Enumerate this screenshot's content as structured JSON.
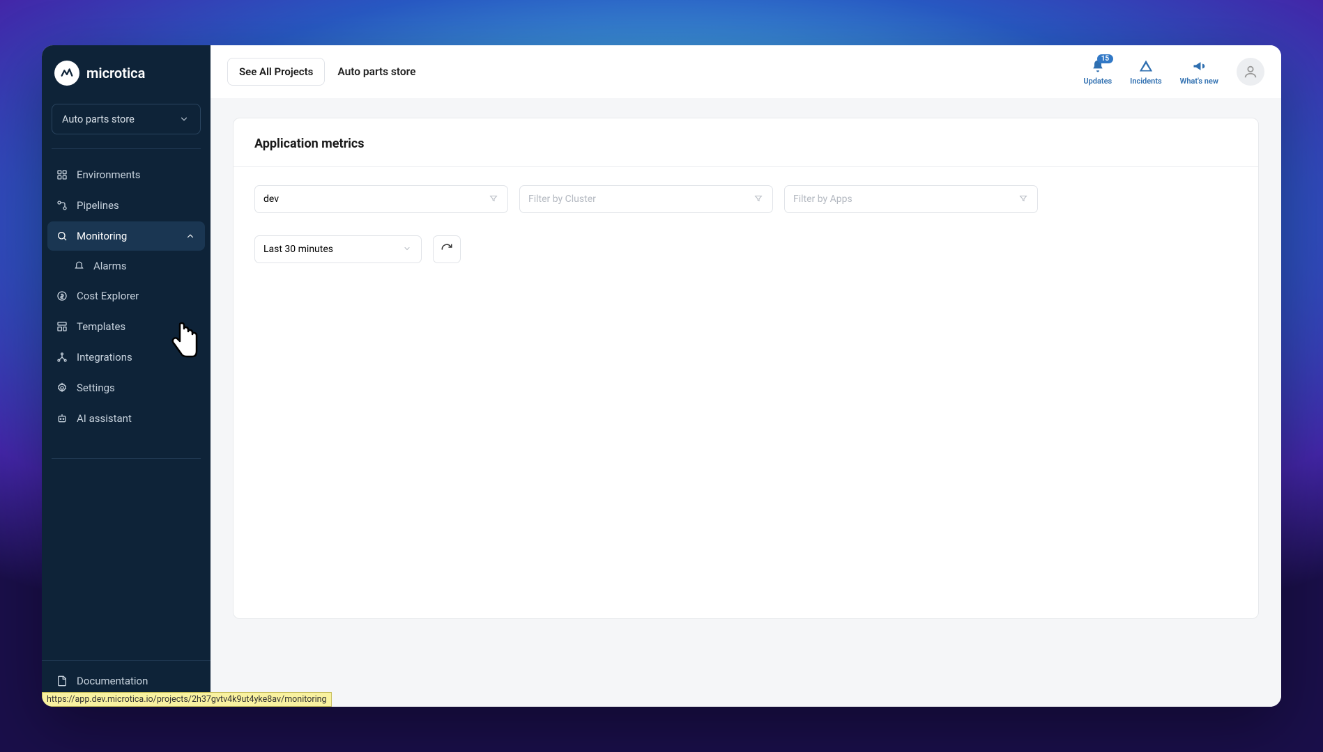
{
  "brand": {
    "name": "microtica"
  },
  "project_select": {
    "value": "Auto parts store"
  },
  "sidebar": {
    "items": [
      {
        "label": "Environments"
      },
      {
        "label": "Pipelines"
      },
      {
        "label": "Monitoring"
      },
      {
        "label": "Alarms"
      },
      {
        "label": "Cost Explorer"
      },
      {
        "label": "Templates"
      },
      {
        "label": "Integrations"
      },
      {
        "label": "Settings"
      },
      {
        "label": "AI assistant"
      }
    ],
    "footer": {
      "documentation": "Documentation"
    }
  },
  "topbar": {
    "see_all": "See All Projects",
    "project_name": "Auto parts store",
    "actions": {
      "updates": {
        "label": "Updates",
        "badge": "15"
      },
      "incidents": {
        "label": "Incidents"
      },
      "whatsnew": {
        "label": "What's new"
      }
    }
  },
  "card": {
    "title": "Application metrics",
    "filters": {
      "env_value": "dev",
      "cluster_placeholder": "Filter by Cluster",
      "apps_placeholder": "Filter by Apps",
      "time_value": "Last 30 minutes"
    }
  },
  "status_url": "https://app.dev.microtica.io/projects/2h37gvtv4k9ut4yke8av/monitoring"
}
